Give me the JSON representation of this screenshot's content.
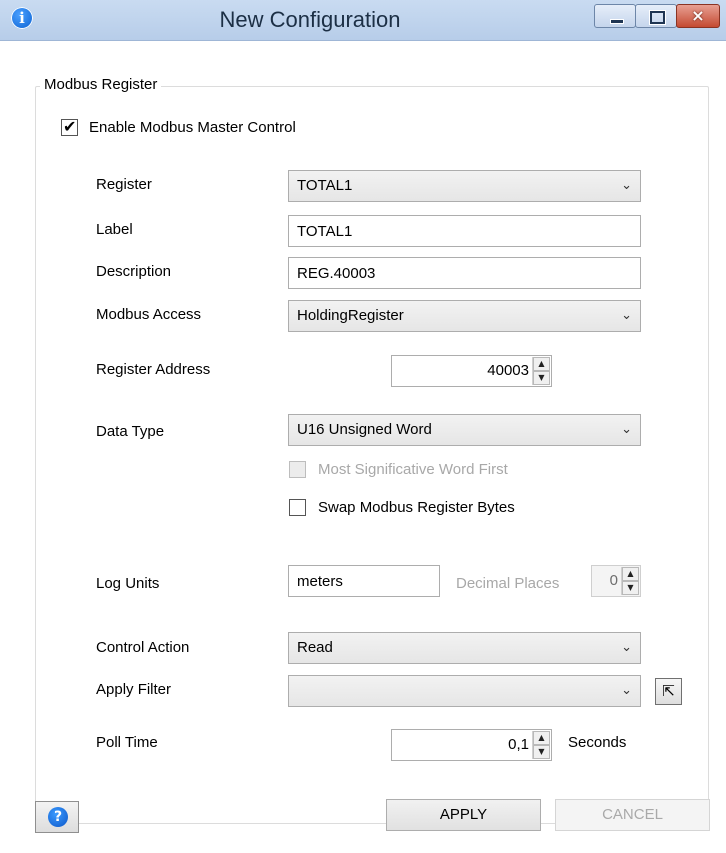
{
  "window": {
    "title": "New Configuration",
    "info_icon": "i",
    "close_glyph": "×"
  },
  "group": {
    "title": "Modbus Register"
  },
  "enable_master": {
    "label": "Enable Modbus Master Control",
    "checked": true
  },
  "fields": {
    "register": {
      "label": "Register",
      "value": "TOTAL1"
    },
    "label": {
      "label": "Label",
      "value": "TOTAL1"
    },
    "description": {
      "label": "Description",
      "value": "REG.40003"
    },
    "modbus_access": {
      "label": "Modbus Access",
      "value": "HoldingRegister"
    },
    "register_address": {
      "label": "Register Address",
      "value": "40003"
    },
    "data_type": {
      "label": "Data Type",
      "value": "U16 Unsigned Word"
    },
    "msw_first": {
      "label": "Most Significative Word First",
      "checked": false,
      "enabled": false
    },
    "swap_bytes": {
      "label": "Swap Modbus Register Bytes",
      "checked": false
    },
    "log_units": {
      "label": "Log Units",
      "value": "meters"
    },
    "decimal_places": {
      "label": "Decimal Places",
      "value": "0"
    },
    "control_action": {
      "label": "Control Action",
      "value": "Read"
    },
    "apply_filter": {
      "label": "Apply Filter",
      "value": ""
    },
    "poll_time": {
      "label": "Poll Time",
      "value": "0,1",
      "unit": "Seconds"
    }
  },
  "buttons": {
    "apply": "APPLY",
    "cancel": "CANCEL",
    "help": "?"
  },
  "icons": {
    "chevron": "chevron-down-icon",
    "spin_up": "▲",
    "spin_down": "▼",
    "popout": "⇱"
  }
}
